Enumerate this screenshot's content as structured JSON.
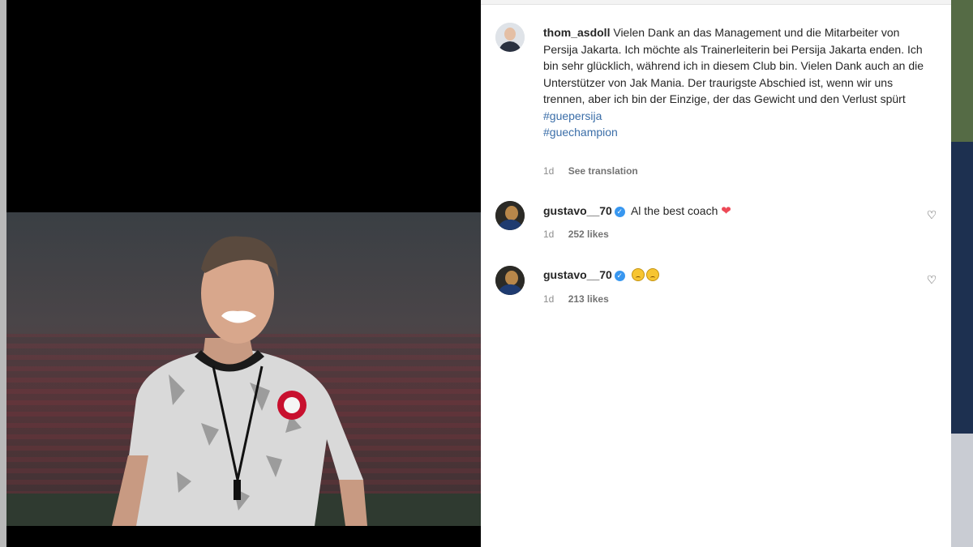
{
  "post": {
    "caption": {
      "username": "thom_asdoll",
      "text": "Vielen Dank an das Management und die Mitarbeiter von Persija Jakarta. Ich möchte als Trainerleiterin bei Persija Jakarta enden. Ich bin sehr glücklich, während ich in diesem Club bin. Vielen Dank auch an die Unterstützer von Jak Mania. Der traurigste Abschied ist, wenn wir uns trennen, aber ich bin der Einzige, der das Gewicht und den Verlust spürt",
      "hashtags": [
        "#guepersija",
        "#guechampion"
      ],
      "age": "1d",
      "see_translation": "See translation"
    },
    "comments": [
      {
        "username": "gustavo__70",
        "verified": true,
        "text": "Al the best coach",
        "emoji": "red-heart",
        "age": "1d",
        "likes": "252 likes"
      },
      {
        "username": "gustavo__70",
        "verified": true,
        "text": "",
        "emoji": "sad-faces-x2",
        "age": "1d",
        "likes": "213 likes"
      }
    ]
  },
  "icons": {
    "verified": "verified-badge-icon",
    "like": "heart-outline-icon"
  },
  "colors": {
    "link": "#3b6ea8",
    "verified": "#3897f0",
    "heart": "#ed4956",
    "meta": "#8e8e8e"
  }
}
